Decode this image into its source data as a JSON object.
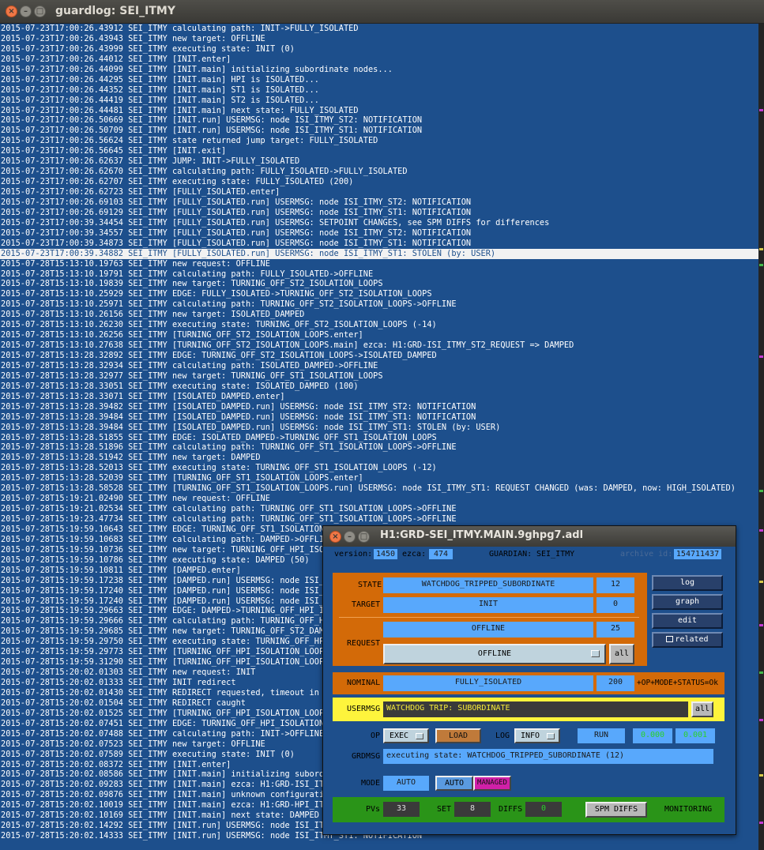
{
  "window": {
    "title": "guardlog: SEI_ITMY"
  },
  "log": [
    "2015-07-23T17:00:26.43912 SEI_ITMY calculating path: INIT->FULLY_ISOLATED",
    "2015-07-23T17:00:26.43943 SEI_ITMY new target: OFFLINE",
    "2015-07-23T17:00:26.43999 SEI_ITMY executing state: INIT (0)",
    "2015-07-23T17:00:26.44012 SEI_ITMY [INIT.enter]",
    "2015-07-23T17:00:26.44099 SEI_ITMY [INIT.main] initializing subordinate nodes...",
    "2015-07-23T17:00:26.44295 SEI_ITMY [INIT.main] HPI is ISOLATED...",
    "2015-07-23T17:00:26.44352 SEI_ITMY [INIT.main] ST1 is ISOLATED...",
    "2015-07-23T17:00:26.44419 SEI_ITMY [INIT.main] ST2 is ISOLATED...",
    "2015-07-23T17:00:26.44481 SEI_ITMY [INIT.main] next state: FULLY_ISOLATED",
    "2015-07-23T17:00:26.50669 SEI_ITMY [INIT.run] USERMSG: node ISI_ITMY_ST2: NOTIFICATION",
    "2015-07-23T17:00:26.50709 SEI_ITMY [INIT.run] USERMSG: node ISI_ITMY_ST1: NOTIFICATION",
    "2015-07-23T17:00:26.56624 SEI_ITMY state returned jump target: FULLY_ISOLATED",
    "2015-07-23T17:00:26.56645 SEI_ITMY [INIT.exit]",
    "2015-07-23T17:00:26.62637 SEI_ITMY JUMP: INIT->FULLY_ISOLATED",
    "2015-07-23T17:00:26.62670 SEI_ITMY calculating path: FULLY_ISOLATED->FULLY_ISOLATED",
    "2015-07-23T17:00:26.62707 SEI_ITMY executing state: FULLY_ISOLATED (200)",
    "2015-07-23T17:00:26.62723 SEI_ITMY [FULLY_ISOLATED.enter]",
    "2015-07-23T17:00:26.69103 SEI_ITMY [FULLY_ISOLATED.run] USERMSG: node ISI_ITMY_ST2: NOTIFICATION",
    "2015-07-23T17:00:26.69129 SEI_ITMY [FULLY_ISOLATED.run] USERMSG: node ISI_ITMY_ST1: NOTIFICATION",
    "2015-07-23T17:00:39.34454 SEI_ITMY [FULLY_ISOLATED.run] USERMSG: SETPOINT CHANGES, see SPM DIFFS for differences",
    "2015-07-23T17:00:39.34557 SEI_ITMY [FULLY_ISOLATED.run] USERMSG: node ISI_ITMY_ST2: NOTIFICATION",
    "2015-07-23T17:00:39.34873 SEI_ITMY [FULLY_ISOLATED.run] USERMSG: node ISI_ITMY_ST1: NOTIFICATION",
    "2015-07-23T17:00:39.34882 SEI_ITMY [FULLY_ISOLATED.run] USERMSG: node ISI_ITMY_ST1: STOLEN (by: USER)",
    "2015-07-28T15:13:10.19763 SEI_ITMY new request: OFFLINE",
    "2015-07-28T15:13:10.19791 SEI_ITMY calculating path: FULLY_ISOLATED->OFFLINE",
    "2015-07-28T15:13:10.19839 SEI_ITMY new target: TURNING_OFF_ST2_ISOLATION_LOOPS",
    "2015-07-28T15:13:10.25929 SEI_ITMY EDGE: FULLY_ISOLATED->TURNING_OFF_ST2_ISOLATION_LOOPS",
    "2015-07-28T15:13:10.25971 SEI_ITMY calculating path: TURNING_OFF_ST2_ISOLATION_LOOPS->OFFLINE",
    "2015-07-28T15:13:10.26156 SEI_ITMY new target: ISOLATED_DAMPED",
    "2015-07-28T15:13:10.26230 SEI_ITMY executing state: TURNING_OFF_ST2_ISOLATION_LOOPS (-14)",
    "2015-07-28T15:13:10.26256 SEI_ITMY [TURNING_OFF_ST2_ISOLATION_LOOPS.enter]",
    "2015-07-28T15:13:10.27638 SEI_ITMY [TURNING_OFF_ST2_ISOLATION_LOOPS.main] ezca: H1:GRD-ISI_ITMY_ST2_REQUEST => DAMPED",
    "2015-07-28T15:13:28.32892 SEI_ITMY EDGE: TURNING_OFF_ST2_ISOLATION_LOOPS->ISOLATED_DAMPED",
    "2015-07-28T15:13:28.32934 SEI_ITMY calculating path: ISOLATED_DAMPED->OFFLINE",
    "2015-07-28T15:13:28.32977 SEI_ITMY new target: TURNING_OFF_ST1_ISOLATION_LOOPS",
    "2015-07-28T15:13:28.33051 SEI_ITMY executing state: ISOLATED_DAMPED (100)",
    "2015-07-28T15:13:28.33071 SEI_ITMY [ISOLATED_DAMPED.enter]",
    "2015-07-28T15:13:28.39482 SEI_ITMY [ISOLATED_DAMPED.run] USERMSG: node ISI_ITMY_ST2: NOTIFICATION",
    "2015-07-28T15:13:28.39484 SEI_ITMY [ISOLATED_DAMPED.run] USERMSG: node ISI_ITMY_ST1: NOTIFICATION",
    "2015-07-28T15:13:28.39484 SEI_ITMY [ISOLATED_DAMPED.run] USERMSG: node ISI_ITMY_ST1: STOLEN (by: USER)",
    "2015-07-28T15:13:28.51855 SEI_ITMY EDGE: ISOLATED_DAMPED->TURNING_OFF_ST1_ISOLATION_LOOPS",
    "2015-07-28T15:13:28.51896 SEI_ITMY calculating path: TURNING_OFF_ST1_ISOLATION_LOOPS->OFFLINE",
    "2015-07-28T15:13:28.51942 SEI_ITMY new target: DAMPED",
    "2015-07-28T15:13:28.52013 SEI_ITMY executing state: TURNING_OFF_ST1_ISOLATION_LOOPS (-12)",
    "2015-07-28T15:13:28.52039 SEI_ITMY [TURNING_OFF_ST1_ISOLATION_LOOPS.enter]",
    "2015-07-28T15:13:28.58528 SEI_ITMY [TURNING_OFF_ST1_ISOLATION_LOOPS.run] USERMSG: node ISI_ITMY_ST1: REQUEST CHANGED (was: DAMPED, now: HIGH_ISOLATED)",
    "2015-07-28T15:19:21.02490 SEI_ITMY new request: OFFLINE",
    "2015-07-28T15:19:21.02534 SEI_ITMY calculating path: TURNING_OFF_ST1_ISOLATION_LOOPS->OFFLINE",
    "2015-07-28T15:19:23.47734 SEI_ITMY calculating path: TURNING_OFF_ST1_ISOLATION_LOOPS->OFFLINE",
    "2015-07-28T15:19:59.10643 SEI_ITMY EDGE: TURNING_OFF_ST1_ISOLATION_L",
    "2015-07-28T15:19:59.10683 SEI_ITMY calculating path: DAMPED->OFFLINE",
    "2015-07-28T15:19:59.10736 SEI_ITMY new target: TURNING_OFF_HPI_ISOLA",
    "2015-07-28T15:19:59.10786 SEI_ITMY executing state: DAMPED (50)",
    "2015-07-28T15:19:59.10811 SEI_ITMY [DAMPED.enter]",
    "2015-07-28T15:19:59.17238 SEI_ITMY [DAMPED.run] USERMSG: node ISI_IT",
    "2015-07-28T15:19:59.17240 SEI_ITMY [DAMPED.run] USERMSG: node ISI_IT",
    "2015-07-28T15:19:59.17240 SEI_ITMY [DAMPED.run] USERMSG: node ISI_IT",
    "2015-07-28T15:19:59.29663 SEI_ITMY EDGE: DAMPED->TURNING_OFF_HPI_ISO",
    "2015-07-28T15:19:59.29666 SEI_ITMY calculating path: TURNING_OFF_HPI",
    "2015-07-28T15:19:59.29685 SEI_ITMY new target: TURNING_OFF_ST2_DAMPI",
    "2015-07-28T15:19:59.29750 SEI_ITMY executing state: TURNING_OFF_HPI_",
    "2015-07-28T15:19:59.29773 SEI_ITMY [TURNING_OFF_HPI_ISOLATION_LOOPS.",
    "2015-07-28T15:19:59.31290 SEI_ITMY [TURNING_OFF_HPI_ISOLATION_LOOPS.",
    "2015-07-28T15:20:02.01303 SEI_ITMY new request: INIT",
    "2015-07-28T15:20:02.01333 SEI_ITMY INIT redirect",
    "2015-07-28T15:20:02.01430 SEI_ITMY REDIRECT requested, timeout in 1.",
    "2015-07-28T15:20:02.01504 SEI_ITMY REDIRECT caught",
    "2015-07-28T15:20:02.01525 SEI_ITMY [TURNING_OFF_HPI_ISOLATION_LOOPS.",
    "2015-07-28T15:20:02.07451 SEI_ITMY EDGE: TURNING_OFF_HPI_ISOLATION_L",
    "2015-07-28T15:20:02.07488 SEI_ITMY calculating path: INIT->OFFLINE",
    "2015-07-28T15:20:02.07523 SEI_ITMY new target: OFFLINE",
    "2015-07-28T15:20:02.07589 SEI_ITMY executing state: INIT (0)",
    "2015-07-28T15:20:02.08372 SEI_ITMY [INIT.enter]",
    "2015-07-28T15:20:02.08586 SEI_ITMY [INIT.main] initializing subordin",
    "2015-07-28T15:20:02.09283 SEI_ITMY [INIT.main] ezca: H1:GRD-ISI_ITMY",
    "2015-07-28T15:20:02.09876 SEI_ITMY [INIT.main] unknown configuration",
    "2015-07-28T15:20:02.10019 SEI_ITMY [INIT.main] ezca: H1:GRD-HPI_ITMY",
    "2015-07-28T15:20:02.10169 SEI_ITMY [INIT.main] next state: DAMPED",
    "2015-07-28T15:20:02.14292 SEI_ITMY [INIT.run] USERMSG: node ISI_ITMY_ST2: NOTIFICATION",
    "2015-07-28T15:20:02.14333 SEI_ITMY [INIT.run] USERMSG: node ISI_ITMY_ST1: NOTIFICATION"
  ],
  "highlight_index": 22,
  "medm": {
    "title": "H1:GRD-SEI_ITMY.MAIN.9ghpg7.adl",
    "version_label": "version:",
    "version": "1450",
    "ezca_label": "ezca:",
    "ezca": "474",
    "guardian_label": "GUARDIAN:",
    "guardian": "SEI_ITMY",
    "archive_label": "archive id:",
    "archive_id": "154711437",
    "state_label": "STATE",
    "state": "WATCHDOG_TRIPPED_SUBORDINATE",
    "state_index": "12",
    "target_label": "TARGET",
    "target": "INIT",
    "target_index": "0",
    "request_label": "REQUEST",
    "request": "OFFLINE",
    "request_index": "25",
    "request_select": "OFFLINE",
    "all_label": "all",
    "log_button": "log",
    "graph_button": "graph",
    "edit_button": "edit",
    "related_button": "related",
    "nominal_label": "NOMINAL",
    "nominal": "FULLY_ISOLATED",
    "nominal_index": "200",
    "status_flags": "+OP+MODE+STATUS=Ok",
    "usermsg_label": "USERMSG",
    "usermsg": "WATCHDOG TRIP: SUBORDINATE",
    "usermsg_all": "all",
    "op_label": "OP",
    "op_select": "EXEC",
    "load_button": "LOAD",
    "log_label": "LOG",
    "log_select": "INFO",
    "run_label": "RUN",
    "run_val1": "0.000",
    "run_val2": "0.001",
    "grdmsg_label": "GRDMSG",
    "grdmsg": "executing state: WATCHDOG_TRIPPED_SUBORDINATE (12)",
    "mode_label": "MODE",
    "mode": "AUTO",
    "mode_auto_button": "AUTO",
    "mode_managed_button": "MANAGED",
    "pvs_label": "PVs",
    "pvs": "33",
    "set_label": "SET",
    "set": "8",
    "diffs_label": "DIFFS",
    "diffs": "0",
    "spm_button": "SPM DIFFS",
    "monitoring_label": "MONITORING"
  },
  "colors": {
    "log_bg": "#1d4f8c",
    "highlight_bg": "#f2f2f2",
    "medm_blue": "#58a8fc",
    "medm_orange": "#d36a08",
    "medm_yellow": "#fef43c",
    "medm_green": "#2a9418",
    "managed_magenta": "#d020a8"
  }
}
